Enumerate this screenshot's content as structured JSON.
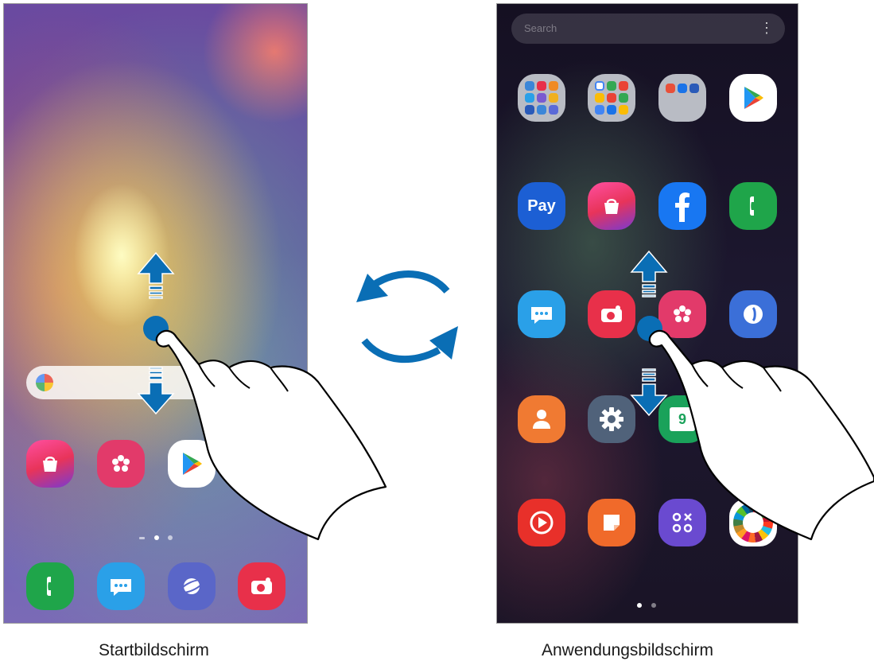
{
  "captions": {
    "home": "Startbildschirm",
    "apps": "Anwendungsbildschirm"
  },
  "apps_screen": {
    "search_placeholder": "Search",
    "more_icon": "more-vert-icon",
    "pay_label": "Pay",
    "calendar_day": "9"
  },
  "colors": {
    "arrow_blue": "#0a6eb5",
    "hand_stroke": "#000000"
  },
  "page_indicator": {
    "home_pages": 3,
    "home_active": 2,
    "apps_pages": 2,
    "apps_active": 1
  }
}
